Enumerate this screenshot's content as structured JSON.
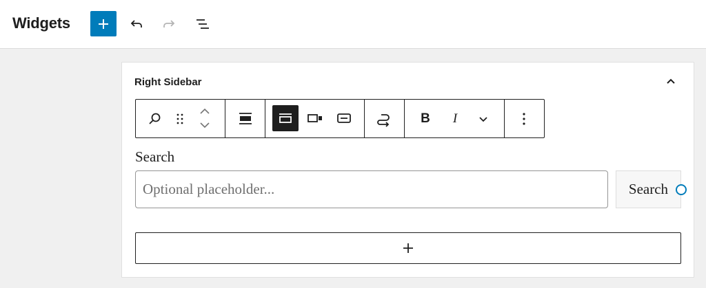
{
  "header": {
    "title": "Widgets",
    "add_icon": "plus-icon",
    "undo_icon": "undo-icon",
    "redo_icon": "redo-icon",
    "list_view_icon": "list-view-icon",
    "accent_color": "#007cba"
  },
  "sidebar_panel": {
    "title": "Right Sidebar",
    "collapse_icon": "chevron-up-icon"
  },
  "toolbar": {
    "items": [
      {
        "name": "search-block-icon"
      },
      {
        "name": "drag-handle-icon"
      },
      {
        "name": "move-up-icon"
      },
      {
        "name": "move-down-icon"
      },
      {
        "name": "align-icon"
      },
      {
        "name": "button-outside-icon",
        "active": true
      },
      {
        "name": "button-inside-icon"
      },
      {
        "name": "no-button-icon"
      },
      {
        "name": "use-button-icon"
      },
      {
        "name": "bold-icon",
        "text": "B"
      },
      {
        "name": "italic-icon",
        "text": "I"
      },
      {
        "name": "more-formatting-icon"
      },
      {
        "name": "options-icon"
      }
    ]
  },
  "search_block": {
    "label": "Search",
    "placeholder": "Optional placeholder...",
    "button_label": "Search"
  },
  "appender": {
    "icon": "plus-icon"
  }
}
